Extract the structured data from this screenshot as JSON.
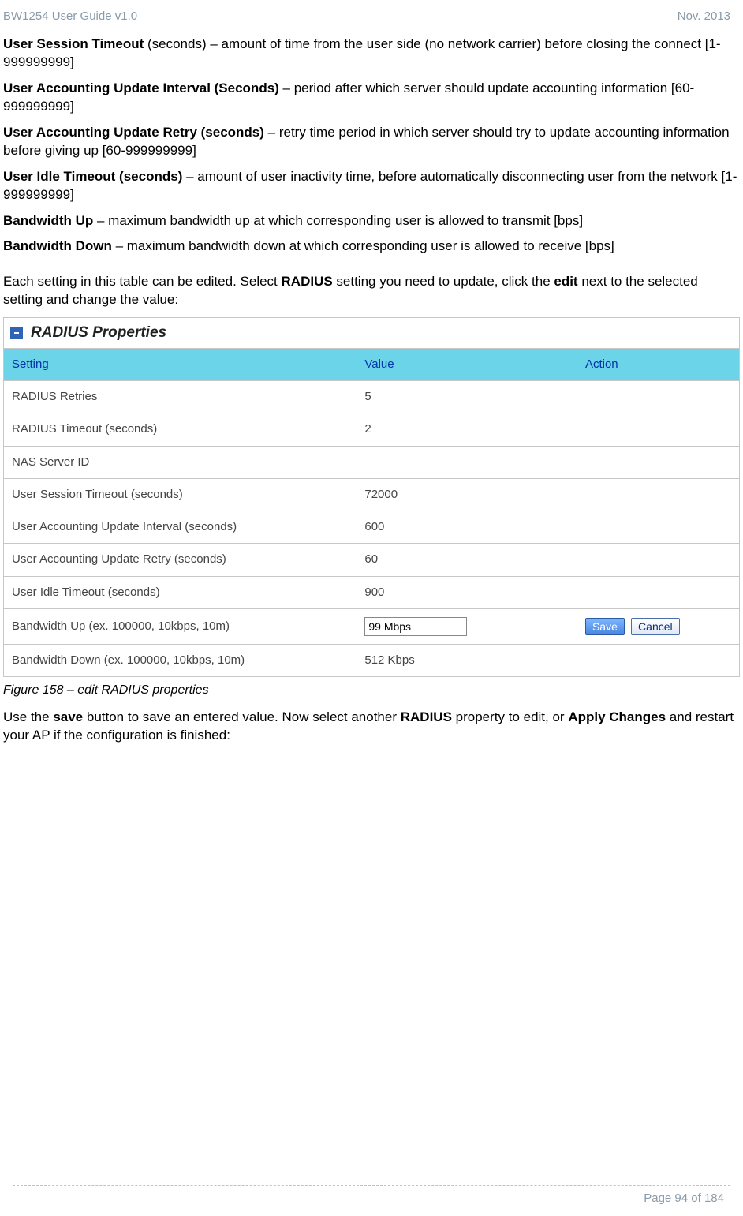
{
  "header": {
    "left": "BW1254 User Guide v1.0",
    "right": "Nov.  2013"
  },
  "paragraphs": {
    "p1_bold": "User Session Timeout",
    "p1_rest": " (seconds) – amount of time from the user side (no network carrier) before closing the connect [1-999999999]",
    "p2_bold": "User Accounting Update Interval (Seconds)",
    "p2_rest": " – period after which server should update accounting information [60-999999999]",
    "p3_bold": "User Accounting Update Retry (seconds)",
    "p3_rest": " – retry time period in which server should try to update accounting information before giving up [60-999999999]",
    "p4_bold": "User Idle Timeout (seconds)",
    "p4_rest": " – amount of user inactivity time, before automatically disconnecting user from the network [1-999999999]",
    "p5_bold": "Bandwidth Up",
    "p5_rest": " – maximum bandwidth up at which corresponding user is allowed to transmit [bps]",
    "p6_bold": "Bandwidth Down",
    "p6_rest": " – maximum bandwidth down at which corresponding user is allowed to receive [bps]",
    "intro_a": "Each setting in this table can be edited. Select ",
    "intro_b": "RADIUS",
    "intro_c": " setting you need to update, click the ",
    "intro_d": "edit",
    "intro_e": " next to the selected setting and change the value:",
    "caption": "Figure 158 – edit RADIUS properties",
    "post_a": "Use the ",
    "post_b": "save",
    "post_c": " button to save an entered value. Now select another ",
    "post_d": "RADIUS",
    "post_e": " property to edit, or ",
    "post_f": "Apply Changes",
    "post_g": " and restart your AP if the configuration is finished:"
  },
  "panel": {
    "title": "RADIUS Properties",
    "icon_symbol": "▣",
    "headers": {
      "setting": "Setting",
      "value": "Value",
      "action": "Action"
    },
    "rows": [
      {
        "setting": "RADIUS Retries",
        "value": "5",
        "editing": false
      },
      {
        "setting": "RADIUS Timeout (seconds)",
        "value": "2",
        "editing": false
      },
      {
        "setting": "NAS Server ID",
        "value": "",
        "editing": false
      },
      {
        "setting": "User Session Timeout (seconds)",
        "value": "72000",
        "editing": false
      },
      {
        "setting": "User Accounting Update Interval (seconds)",
        "value": "600",
        "editing": false
      },
      {
        "setting": "User Accounting Update Retry (seconds)",
        "value": "60",
        "editing": false
      },
      {
        "setting": "User Idle Timeout (seconds)",
        "value": "900",
        "editing": false
      },
      {
        "setting": "Bandwidth Up (ex. 100000, 10kbps, 10m)",
        "value": "99 Mbps",
        "editing": true
      },
      {
        "setting": "Bandwidth Down (ex. 100000, 10kbps, 10m)",
        "value": "512 Kbps",
        "editing": false
      }
    ],
    "buttons": {
      "save": "Save",
      "cancel": "Cancel"
    }
  },
  "footer": {
    "page": "Page 94 of 184"
  }
}
